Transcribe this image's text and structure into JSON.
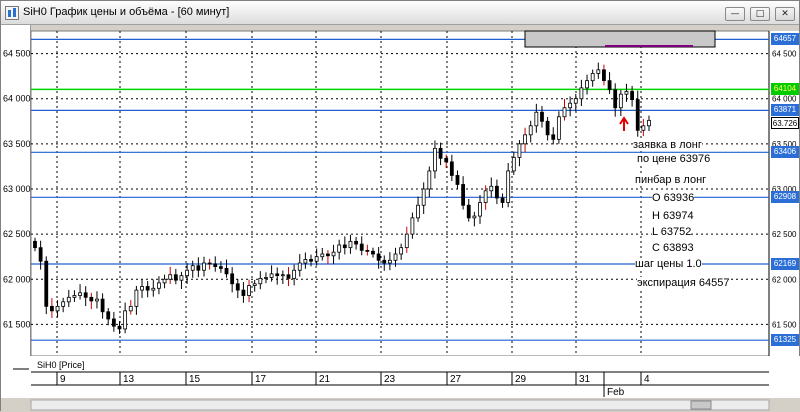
{
  "window": {
    "title": "SiH0 График цены и объёма - [60 минут]",
    "buttons": {
      "minimize": "—",
      "restore": "□",
      "close": "✕"
    }
  },
  "chart": {
    "series_label": "SiH0 [Price]",
    "y_ticks": [
      "64 500",
      "64 000",
      "63 500",
      "63 000",
      "62 500",
      "62 000",
      "61 500"
    ],
    "x_ticks": [
      "9",
      "13",
      "15",
      "17",
      "21",
      "23",
      "27",
      "29",
      "31",
      "4"
    ],
    "x_month": "Feb",
    "price_tags": [
      {
        "label": "64657",
        "color": "#2b6fd6",
        "kind": "blue"
      },
      {
        "label": "64104",
        "color": "#00cc00",
        "kind": "green"
      },
      {
        "label": "63871",
        "color": "#2b6fd6",
        "kind": "blue"
      },
      {
        "label": "63.726",
        "color": "#000000",
        "kind": "current"
      },
      {
        "label": "63406",
        "color": "#2b6fd6",
        "kind": "blue"
      },
      {
        "label": "62908",
        "color": "#2b6fd6",
        "kind": "blue"
      },
      {
        "label": "62169",
        "color": "#2b6fd6",
        "kind": "blue"
      },
      {
        "label": "61325",
        "color": "#2b6fd6",
        "kind": "blue"
      }
    ],
    "levels": [
      64657,
      64104,
      63871,
      63406,
      62908,
      62169,
      61325
    ],
    "accent_colors": {
      "level_line": "#1f5fd0",
      "green_line": "#00d400",
      "bull": "#000000",
      "bear": "#000000",
      "wick_alt": "#cc0000",
      "arrow": "#e00000"
    },
    "y_range": [
      61150,
      64750
    ]
  },
  "annotations": {
    "order_line1": "заявка в лонг",
    "order_line2": "по цене 63976",
    "pinbar_title": "пинбар в лонг",
    "open": "O 63936",
    "high": "H 63974",
    "low": "L 63752",
    "close": "C 63893",
    "tick_step": "шаг цены 1.0",
    "expiration": "экспирация 64557"
  },
  "icons": {
    "app": "chart-app-icon",
    "arrow": "up-arrow-icon"
  }
}
